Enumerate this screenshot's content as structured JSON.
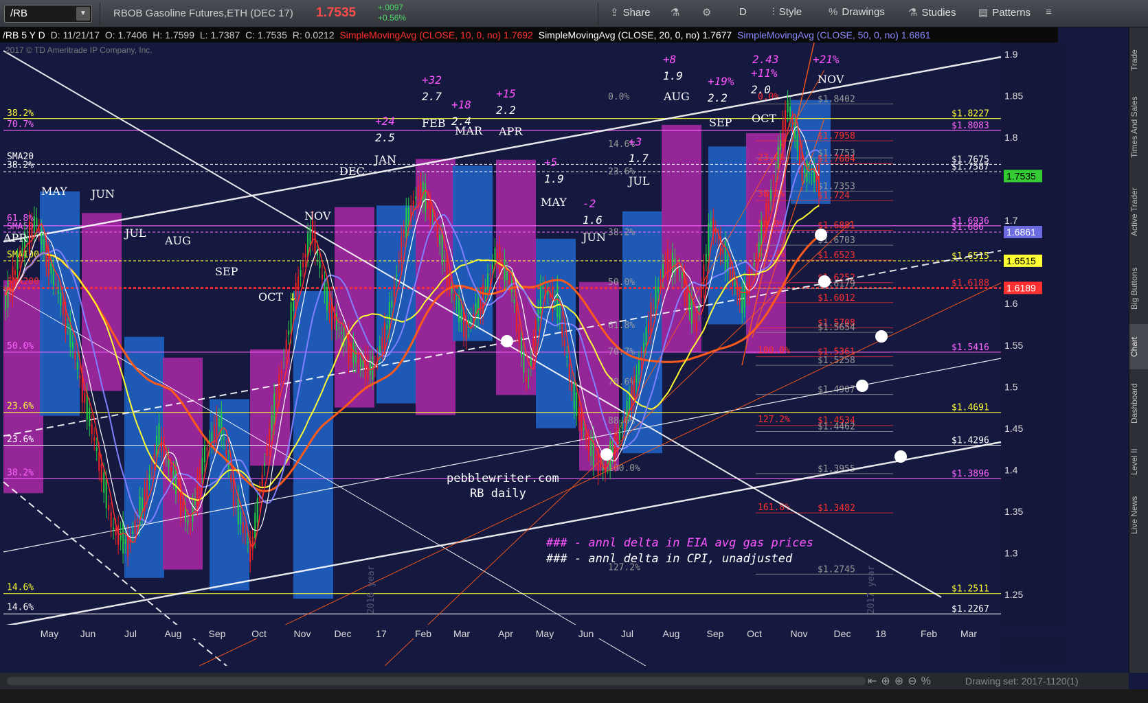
{
  "toolbar": {
    "symbol": "/RB",
    "title": "RBOB Gasoline Futures,ETH (DEC 17)",
    "price": "1.7535",
    "change_abs": "+.0097",
    "change_pct": "+0.56%",
    "share": "Share",
    "style": "Style",
    "drawings": "Drawings",
    "studies": "Studies",
    "patterns": "Patterns",
    "period": "D"
  },
  "infobar": {
    "symbol_tf": "/RB 5 Y D",
    "date": "D: 11/21/17",
    "open": "O: 1.7406",
    "high": "H: 1.7599",
    "low": "L: 1.7387",
    "close": "C: 1.7535",
    "range": "R: 0.0212",
    "sma10": "SimpleMovingAvg (CLOSE, 10, 0, no)  1.7692",
    "sma20": "SimpleMovingAvg (CLOSE, 20, 0, no)  1.7677",
    "sma50": "SimpleMovingAvg (CLOSE, 50, 0, no)  1.6861"
  },
  "copyright": "2017 © TD Ameritrade IP Company, Inc.",
  "watermark_1": "pebblewriter.com",
  "watermark_2": "RB daily",
  "legend_1": "### - annl delta in EIA avg gas prices",
  "legend_2": "### - annl delta in CPI, unadjusted",
  "right_tabs": [
    "Trade",
    "Times And Sales",
    "Active Trader",
    "Big Buttons",
    "Chart",
    "Dashboard",
    "Level II",
    "Live News"
  ],
  "active_tab": "Chart",
  "drawing_set": "Drawing set: 2017-1120(1)",
  "colors": {
    "magenta": "#a0279f",
    "blue": "#1f5fbf",
    "bg": "#16193f",
    "sma10": "#ff3030",
    "sma20": "#ffffff",
    "sma50": "#8080ff",
    "sma100": "#ffff33",
    "sma200": "#ff5a1a"
  },
  "chart_data": {
    "type": "candlestick",
    "ylim": [
      1.2,
      1.92
    ],
    "y_ticks": [
      "1.9",
      "1.85",
      "1.8",
      "1.75",
      "1.7",
      "1.65",
      "1.6",
      "1.55",
      "1.5",
      "1.45",
      "1.4",
      "1.35",
      "1.3",
      "1.25"
    ],
    "x_ticks": [
      "May",
      "Jun",
      "Jul",
      "Aug",
      "Sep",
      "Oct",
      "Nov",
      "Dec",
      "17",
      "Feb",
      "Mar",
      "Apr",
      "May",
      "Jun",
      "Jul",
      "Aug",
      "Sep",
      "Oct",
      "Nov",
      "Dec",
      "18",
      "Feb",
      "Mar"
    ],
    "year_labels": [
      "2016 year",
      "2017 year"
    ],
    "moving_averages": [
      "SMA10",
      "SMA20",
      "SMA50",
      "SMA100",
      "SMA200"
    ],
    "price_bubbles": [
      {
        "label": "1.7535",
        "value": 1.7535,
        "color": "#33cc33",
        "text": "#000000"
      },
      {
        "label": "1.6861",
        "value": 1.6861,
        "color": "#6b6bdf",
        "text": "#ffffff"
      },
      {
        "label": "1.6515",
        "value": 1.6515,
        "color": "#ffff33",
        "text": "#000000"
      },
      {
        "label": "1.6189",
        "value": 1.6189,
        "color": "#ff3030",
        "text": "#ffffff"
      }
    ],
    "horizontal_levels": [
      {
        "label": "$1.8227",
        "value": 1.8227,
        "color": "#ffff33"
      },
      {
        "label": "$1.8083",
        "value": 1.8083,
        "color": "#ff66ff"
      },
      {
        "label": "$1.7675",
        "value": 1.7675,
        "color": "#ffffff"
      },
      {
        "label": "$1.7587",
        "value": 1.7587,
        "color": "#ffffff"
      },
      {
        "label": "$1.6936",
        "value": 1.6936,
        "color": "#ff66ff"
      },
      {
        "label": "$1.686",
        "value": 1.686,
        "color": "#ff66ff"
      },
      {
        "label": "$1.6515",
        "value": 1.6515,
        "color": "#ffff33"
      },
      {
        "label": "$1.6188",
        "value": 1.6188,
        "color": "#ff3030"
      },
      {
        "label": "$1.5416",
        "value": 1.5416,
        "color": "#ff66ff"
      },
      {
        "label": "$1.4691",
        "value": 1.4691,
        "color": "#ffff33"
      },
      {
        "label": "$1.4296",
        "value": 1.4296,
        "color": "#ffffff"
      },
      {
        "label": "$1.3896",
        "value": 1.3896,
        "color": "#ff66ff"
      },
      {
        "label": "$1.2511",
        "value": 1.2511,
        "color": "#ffff33"
      },
      {
        "label": "$1.2267",
        "value": 1.2267,
        "color": "#ffffff"
      }
    ],
    "left_fib_labels": [
      {
        "label": "38.2%",
        "value": 1.823,
        "color": "#ffff33"
      },
      {
        "label": "70.7%",
        "value": 1.81,
        "color": "#ff66ff"
      },
      {
        "label": "SMA20",
        "value": 1.771,
        "color": "#ffffff"
      },
      {
        "label": "38.2%",
        "value": 1.761,
        "color": "#ffffff"
      },
      {
        "label": "61.8%",
        "value": 1.697,
        "color": "#ff66ff"
      },
      {
        "label": "SMA50",
        "value": 1.687,
        "color": "#ff66ff"
      },
      {
        "label": "SMA100",
        "value": 1.653,
        "color": "#ffff33"
      },
      {
        "label": "SMA200",
        "value": 1.621,
        "color": "#ff3030"
      },
      {
        "label": "50.0%",
        "value": 1.543,
        "color": "#ff66ff"
      },
      {
        "label": "23.6%",
        "value": 1.471,
        "color": "#ffff33"
      },
      {
        "label": "23.6%",
        "value": 1.431,
        "color": "#ffffff"
      },
      {
        "label": "38.2%",
        "value": 1.391,
        "color": "#ff66ff"
      },
      {
        "label": "14.6%",
        "value": 1.253,
        "color": "#ffff33"
      },
      {
        "label": "14.6%",
        "value": 1.229,
        "color": "#ffffff"
      }
    ],
    "fib_levels_mid": [
      {
        "label": "$1.8402",
        "value": 1.8402,
        "color": "#999999"
      },
      {
        "label": "$1.7958",
        "value": 1.7958,
        "color": "#ff3030"
      },
      {
        "label": "$1.7753",
        "value": 1.7753,
        "color": "#999999"
      },
      {
        "label": "$1.7684",
        "value": 1.7684,
        "color": "#ff3030"
      },
      {
        "label": "$1.7353",
        "value": 1.7353,
        "color": "#999999"
      },
      {
        "label": "$1.724",
        "value": 1.724,
        "color": "#ff3030"
      },
      {
        "label": "$1.6881",
        "value": 1.6881,
        "color": "#ff3030"
      },
      {
        "label": "$1.6703",
        "value": 1.6703,
        "color": "#999999"
      },
      {
        "label": "$1.6523",
        "value": 1.6523,
        "color": "#ff3030"
      },
      {
        "label": "$1.6252",
        "value": 1.6252,
        "color": "#ff3030"
      },
      {
        "label": "$1.6179",
        "value": 1.6179,
        "color": "#999999"
      },
      {
        "label": "$1.6012",
        "value": 1.6012,
        "color": "#ff3030"
      },
      {
        "label": "$1.5708",
        "value": 1.5708,
        "color": "#ff3030"
      },
      {
        "label": "$1.5654",
        "value": 1.5654,
        "color": "#999999"
      },
      {
        "label": "$1.5361",
        "value": 1.5361,
        "color": "#ff3030"
      },
      {
        "label": "$1.5258",
        "value": 1.5258,
        "color": "#999999"
      },
      {
        "label": "$1.4907",
        "value": 1.4907,
        "color": "#999999"
      },
      {
        "label": "$1.4534",
        "value": 1.4534,
        "color": "#ff3030"
      },
      {
        "label": "$1.4462",
        "value": 1.4462,
        "color": "#999999"
      },
      {
        "label": "$1.3955",
        "value": 1.3955,
        "color": "#999999"
      },
      {
        "label": "$1.3482",
        "value": 1.3482,
        "color": "#ff3030"
      },
      {
        "label": "$1.2745",
        "value": 1.2745,
        "color": "#999999"
      }
    ],
    "fib_pct_labels": [
      {
        "label": "0.0%",
        "value": 1.843,
        "color": "#999999"
      },
      {
        "label": "14.6%",
        "value": 1.786,
        "color": "#999999"
      },
      {
        "label": "23.6%",
        "value": 1.753,
        "color": "#999999"
      },
      {
        "label": "38.2%",
        "value": 1.68,
        "color": "#999999"
      },
      {
        "label": "50.0%",
        "value": 1.62,
        "color": "#999999"
      },
      {
        "label": "61.8%",
        "value": 1.568,
        "color": "#999999"
      },
      {
        "label": "70.7%",
        "value": 1.536,
        "color": "#999999"
      },
      {
        "label": "78.6%",
        "value": 1.5,
        "color": "#999999"
      },
      {
        "label": "88.6%",
        "value": 1.453,
        "color": "#999999"
      },
      {
        "label": "100.0%",
        "value": 1.396,
        "color": "#999999"
      },
      {
        "label": "127.2%",
        "value": 1.277,
        "color": "#999999"
      },
      {
        "label": "0.0%",
        "value": 1.843,
        "color": "#ff3030"
      },
      {
        "label": "23.6%",
        "value": 1.77,
        "color": "#ff3030"
      },
      {
        "label": "38.2%",
        "value": 1.726,
        "color": "#ff3030"
      },
      {
        "label": "50.0%",
        "value": 1.69,
        "color": "#ff3030"
      },
      {
        "label": "61.8%",
        "value": 1.654,
        "color": "#ff3030"
      },
      {
        "label": "100.0%",
        "value": 1.538,
        "color": "#ff3030"
      },
      {
        "label": "127.2%",
        "value": 1.455,
        "color": "#ff3030"
      },
      {
        "label": "161.8%",
        "value": 1.349,
        "color": "#ff3030"
      }
    ],
    "month_blocks": [
      {
        "label": "APR",
        "top": 1.628,
        "bottom": 1.372,
        "color": "magenta"
      },
      {
        "label": "MAY",
        "top": 1.735,
        "bottom": 1.465,
        "color": "blue"
      },
      {
        "label": "JUN",
        "top": 1.709,
        "bottom": 1.495,
        "color": "magenta"
      },
      {
        "label": "JUL",
        "top": 1.56,
        "bottom": 1.27,
        "color": "blue"
      },
      {
        "label": "AUG",
        "top": 1.535,
        "bottom": 1.28,
        "color": "magenta"
      },
      {
        "label": "SEP",
        "top": 1.485,
        "bottom": 1.255,
        "color": "blue"
      },
      {
        "label": "OCT",
        "top": 1.545,
        "bottom": 1.405,
        "color": "magenta"
      },
      {
        "label": "NOV",
        "top": 1.615,
        "bottom": 1.245,
        "color": "blue"
      },
      {
        "label": "DEC",
        "top": 1.716,
        "bottom": 1.475,
        "color": "magenta"
      },
      {
        "label": "JAN",
        "top": 1.718,
        "bottom": 1.48,
        "color": "blue"
      },
      {
        "label": "FEB",
        "top": 1.774,
        "bottom": 1.466,
        "color": "magenta"
      },
      {
        "label": "MAR",
        "top": 1.766,
        "bottom": 1.555,
        "color": "blue"
      },
      {
        "label": "APR",
        "top": 1.773,
        "bottom": 1.49,
        "color": "magenta"
      },
      {
        "label": "MAY",
        "top": 1.678,
        "bottom": 1.45,
        "color": "blue"
      },
      {
        "label": "JUN",
        "top": 1.626,
        "bottom": 1.399,
        "color": "magenta"
      },
      {
        "label": "JUL",
        "top": 1.711,
        "bottom": 1.42,
        "color": "blue"
      },
      {
        "label": "AUG",
        "top": 1.815,
        "bottom": 1.542,
        "color": "magenta"
      },
      {
        "label": "SEP",
        "top": 1.789,
        "bottom": 1.575,
        "color": "blue"
      },
      {
        "label": "OCT",
        "top": 1.805,
        "bottom": 1.54,
        "color": "magenta"
      },
      {
        "label": "NOV",
        "top": 1.845,
        "bottom": 1.72,
        "color": "blue"
      }
    ],
    "month_annotations": [
      {
        "month": "MAY",
        "pct": "",
        "cpi": ""
      },
      {
        "month": "JUN",
        "pct": "",
        "cpi": ""
      },
      {
        "month": "JUL",
        "pct": "",
        "cpi": ""
      },
      {
        "month": "AUG",
        "pct": "",
        "cpi": ""
      },
      {
        "month": "SEP",
        "pct": "",
        "cpi": ""
      },
      {
        "month": "OCT",
        "pct": "",
        "cpi": ""
      },
      {
        "month": "NOV",
        "pct": "",
        "cpi": ""
      },
      {
        "month": "DEC",
        "pct": "",
        "cpi": ""
      },
      {
        "month": "JAN",
        "pct": "+24",
        "cpi": "2.5"
      },
      {
        "month": "FEB",
        "pct": "+32",
        "cpi": "2.7"
      },
      {
        "month": "MAR",
        "pct": "+18",
        "cpi": "2.4"
      },
      {
        "month": "APR",
        "pct": "+15",
        "cpi": "2.2"
      },
      {
        "month": "MAY",
        "pct": "+5",
        "cpi": "1.9"
      },
      {
        "month": "JUN",
        "pct": "-2",
        "cpi": "1.6"
      },
      {
        "month": "JUL",
        "pct": "+3",
        "cpi": "1.7"
      },
      {
        "month": "AUG",
        "pct": "+8",
        "cpi": "1.9"
      },
      {
        "month": "SEP",
        "pct": "+19%",
        "cpi": "2.2"
      },
      {
        "month": "OCT",
        "pct": "+11%",
        "cpi": "2.0"
      },
      {
        "month": "OCT",
        "pct": "2.43",
        "cpi": ""
      },
      {
        "month": "NOV",
        "pct": "+21%",
        "cpi": ""
      }
    ],
    "close_path": [
      1.6,
      1.66,
      1.7,
      1.64,
      1.58,
      1.5,
      1.42,
      1.33,
      1.31,
      1.36,
      1.44,
      1.39,
      1.33,
      1.42,
      1.46,
      1.36,
      1.3,
      1.42,
      1.52,
      1.62,
      1.69,
      1.6,
      1.56,
      1.53,
      1.52,
      1.58,
      1.69,
      1.74,
      1.7,
      1.62,
      1.57,
      1.6,
      1.66,
      1.62,
      1.5,
      1.62,
      1.6,
      1.49,
      1.43,
      1.4,
      1.44,
      1.5,
      1.58,
      1.65,
      1.64,
      1.57,
      1.7,
      1.65,
      1.6,
      1.66,
      1.74,
      1.84,
      1.76,
      1.75
    ]
  }
}
